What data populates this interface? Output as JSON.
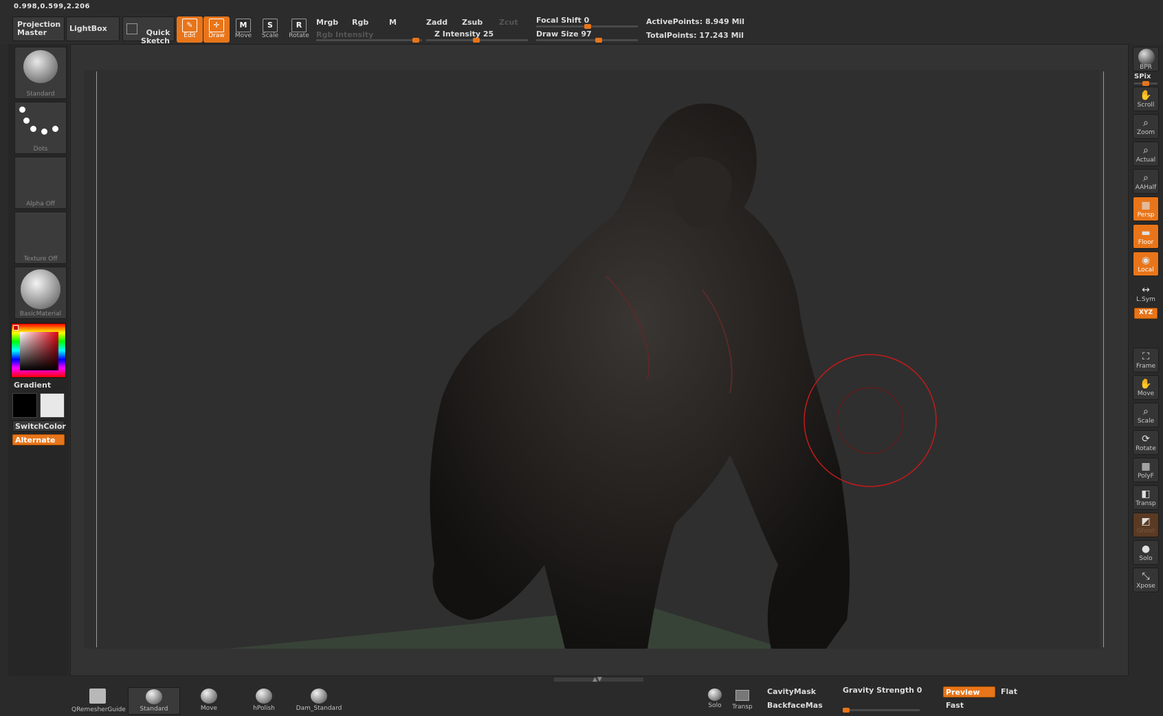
{
  "status": {
    "coords": "0.998,0.599,2.206"
  },
  "top": {
    "projection_master": "Projection\nMaster",
    "lightbox": "LightBox",
    "quick_sketch": "Quick\nSketch",
    "tools": [
      {
        "id": "edit",
        "label": "Edit",
        "glyph": "✎",
        "active": true
      },
      {
        "id": "draw",
        "label": "Draw",
        "glyph": "✛",
        "active": true
      },
      {
        "id": "move",
        "label": "Move",
        "glyph": "M",
        "active": false
      },
      {
        "id": "scale",
        "label": "Scale",
        "glyph": "S",
        "active": false
      },
      {
        "id": "rotate",
        "label": "Rotate",
        "glyph": "R",
        "active": false
      }
    ],
    "mrgb": "Mrgb",
    "rgb": "Rgb",
    "m": "M",
    "rgb_intensity": "Rgb Intensity",
    "zadd": "Zadd",
    "zsub": "Zsub",
    "zcut": "Zcut",
    "z_intensity_label": "Z Intensity",
    "z_intensity_value": "25",
    "focal_shift_label": "Focal Shift",
    "focal_shift_value": "0",
    "draw_size_label": "Draw Size",
    "draw_size_value": "97",
    "active_points": "ActivePoints: 8.949 Mil",
    "total_points": "TotalPoints: 17.243 Mil"
  },
  "left": {
    "brush_label": "Standard",
    "stroke_label": "Dots",
    "alpha_label": "Alpha Off",
    "texture_label": "Texture Off",
    "material_label": "BasicMaterial",
    "gradient": "Gradient",
    "switch_color": "SwitchColor",
    "alternate": "Alternate",
    "color_main": "#000000",
    "color_secondary": "#e8e8e8"
  },
  "right": {
    "bpr": "BPR",
    "spix": "SPix",
    "items": [
      {
        "label": "Scroll",
        "icon": "✋",
        "state": "normal"
      },
      {
        "label": "Zoom",
        "icon": "⌕",
        "state": "normal"
      },
      {
        "label": "Actual",
        "icon": "⌕",
        "state": "normal"
      },
      {
        "label": "AAHalf",
        "icon": "⌕",
        "state": "normal"
      },
      {
        "label": "Persp",
        "icon": "▦",
        "state": "orange"
      },
      {
        "label": "Floor",
        "icon": "▬",
        "state": "orange"
      },
      {
        "label": "Local",
        "icon": "◉",
        "state": "orange"
      },
      {
        "label": "L.Sym",
        "icon": "↔",
        "state": "plain"
      },
      {
        "label": "Frame",
        "icon": "⛶",
        "state": "normal"
      },
      {
        "label": "Move",
        "icon": "✋",
        "state": "normal"
      },
      {
        "label": "Scale",
        "icon": "⌕",
        "state": "normal"
      },
      {
        "label": "Rotate",
        "icon": "⟳",
        "state": "normal"
      },
      {
        "label": "PolyF",
        "icon": "▦",
        "state": "normal"
      },
      {
        "label": "Transp",
        "icon": "◧",
        "state": "normal"
      },
      {
        "label": "Ghost",
        "icon": "◩",
        "state": "faded"
      },
      {
        "label": "Solo",
        "icon": "●",
        "state": "normal"
      },
      {
        "label": "Xpose",
        "icon": "⤡",
        "state": "normal"
      }
    ],
    "xyz": "XYZ"
  },
  "bottom": {
    "brushes": [
      {
        "label": "QRemesherGuide",
        "selected": false
      },
      {
        "label": "Standard",
        "selected": true
      },
      {
        "label": "Move",
        "selected": false
      },
      {
        "label": "hPolish",
        "selected": false
      },
      {
        "label": "Dam_Standard",
        "selected": false
      }
    ],
    "solo": "Solo",
    "transp": "Transp",
    "cavity_mask": "CavityMask",
    "backface_mask": "BackfaceMas",
    "gravity_strength_label": "Gravity Strength",
    "gravity_strength_value": "0",
    "preview": "Preview",
    "flat": "Flat",
    "fast": "Fast"
  },
  "colors": {
    "accent": "#e8751a",
    "brush_cursor": "#c41a1a",
    "model": "#1e1c1b",
    "grid": "#3c4a3c"
  }
}
